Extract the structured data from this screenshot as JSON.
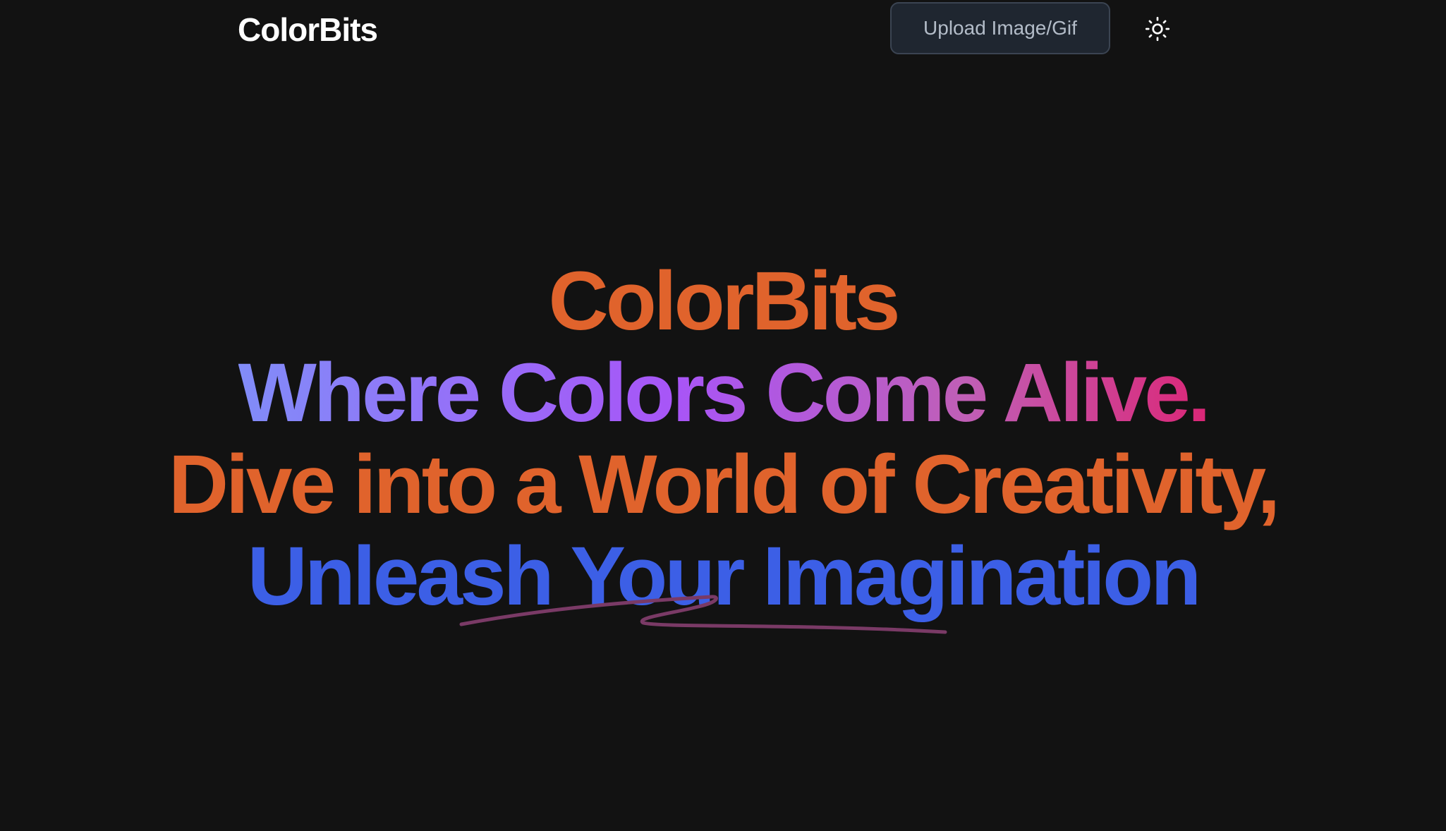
{
  "navbar": {
    "brand": "ColorBits",
    "upload_label": "Upload Image/Gif",
    "theme_icon": "sun-icon"
  },
  "hero": {
    "line1": "ColorBits",
    "line2": "Where Colors Come Alive.",
    "line3": "Dive into a World of Creativity,",
    "line4": "Unleash Your Imagination"
  },
  "colors": {
    "background": "#121212",
    "brand_orange": "#e0632c",
    "gradient_start": "#818cf8",
    "gradient_end": "#db2777",
    "blue": "#3c5fe6",
    "squiggle": "#7a3a66"
  }
}
